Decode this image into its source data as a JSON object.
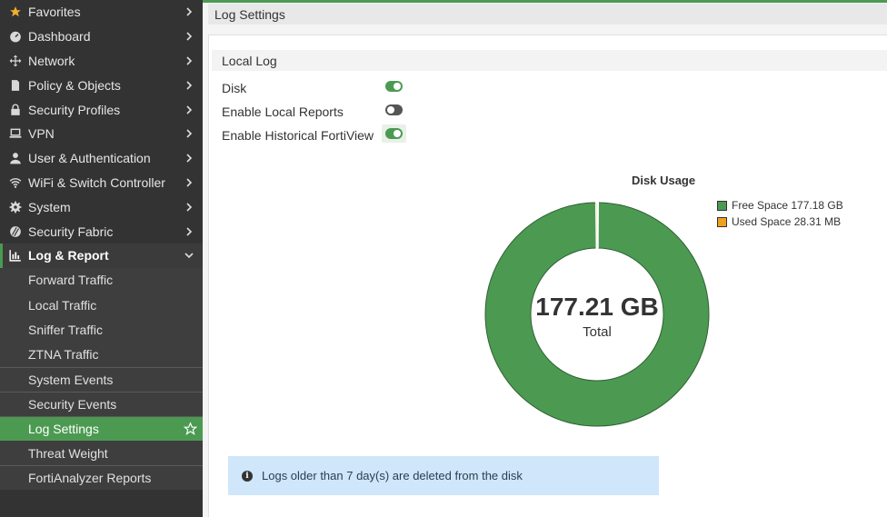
{
  "sidebar": {
    "items": [
      {
        "label": "Favorites",
        "icon": "star-icon"
      },
      {
        "label": "Dashboard",
        "icon": "dashboard-icon"
      },
      {
        "label": "Network",
        "icon": "network-icon"
      },
      {
        "label": "Policy & Objects",
        "icon": "policy-icon"
      },
      {
        "label": "Security Profiles",
        "icon": "lock-icon"
      },
      {
        "label": "VPN",
        "icon": "laptop-icon"
      },
      {
        "label": "User & Authentication",
        "icon": "user-icon"
      },
      {
        "label": "WiFi & Switch Controller",
        "icon": "wifi-icon"
      },
      {
        "label": "System",
        "icon": "gear-icon"
      },
      {
        "label": "Security Fabric",
        "icon": "fabric-icon"
      },
      {
        "label": "Log & Report",
        "icon": "chart-icon"
      }
    ],
    "sub_items": [
      {
        "label": "Forward Traffic"
      },
      {
        "label": "Local Traffic"
      },
      {
        "label": "Sniffer Traffic"
      },
      {
        "label": "ZTNA Traffic"
      },
      {
        "label": "System Events"
      },
      {
        "label": "Security Events"
      },
      {
        "label": "Log Settings"
      },
      {
        "label": "Threat Weight"
      },
      {
        "label": "FortiAnalyzer Reports"
      }
    ]
  },
  "page": {
    "title": "Log Settings",
    "section": "Local Log",
    "options": [
      {
        "label": "Disk",
        "enabled": true
      },
      {
        "label": "Enable Local Reports",
        "enabled": false
      },
      {
        "label": "Enable Historical FortiView",
        "enabled": true
      }
    ],
    "info": "Logs older than 7 day(s) are deleted from the disk"
  },
  "chart_data": {
    "type": "pie",
    "title": "Disk Usage",
    "center_value": "177.21 GB",
    "center_label": "Total",
    "legend_position": "top-right",
    "series": [
      {
        "name": "Free Space 177.18 GB",
        "value": 177.18,
        "color": "#4c9a52"
      },
      {
        "name": "Used Space 28.31 MB",
        "value": 0.02831,
        "color": "#f0a020"
      }
    ]
  },
  "colors": {
    "accent": "#4c9a52",
    "sidebar": "#333333",
    "info_bg": "#cfe6fb"
  }
}
